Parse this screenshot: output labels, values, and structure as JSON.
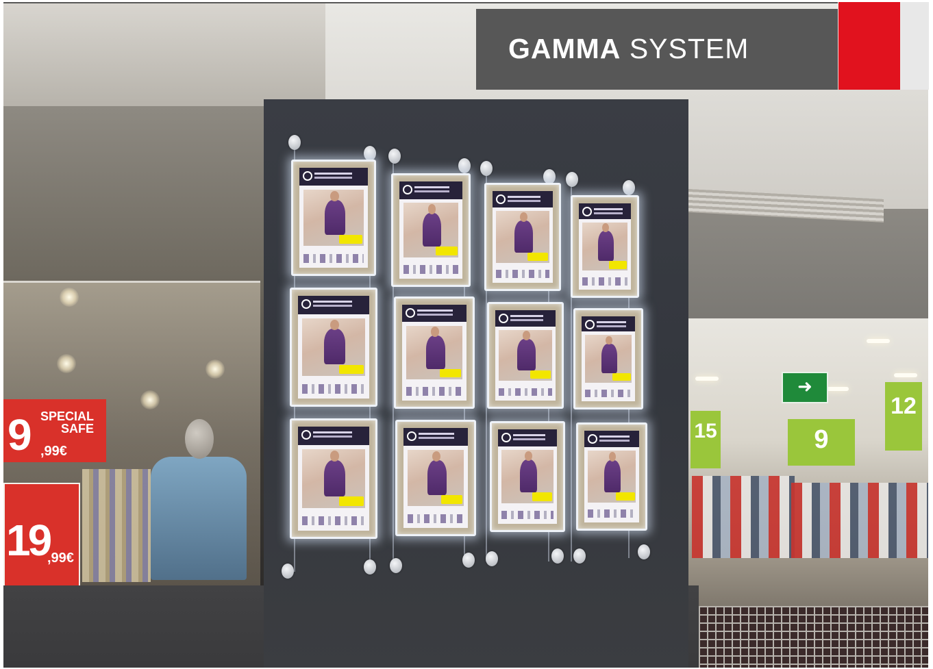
{
  "brand": {
    "title_strong": "GAMMA",
    "title_light": "SYSTEM",
    "colors": {
      "bar": "#575757",
      "accent_red": "#e1121e",
      "accent_grey": "#e8e8e8"
    }
  },
  "photo": {
    "left_store_signs": [
      {
        "label": "SPECIAL SAFE",
        "big": "9",
        "small": ",99€"
      },
      {
        "big": "19",
        "small": ",99€"
      }
    ],
    "right_store_banners": [
      "15",
      "9",
      "12"
    ],
    "exit_sign_icon": "running-man-arrow-icon",
    "display_panels": {
      "rows": 3,
      "columns": 4,
      "poster_color": "#6b3f86",
      "price_tag_color": "#f2e600"
    }
  }
}
